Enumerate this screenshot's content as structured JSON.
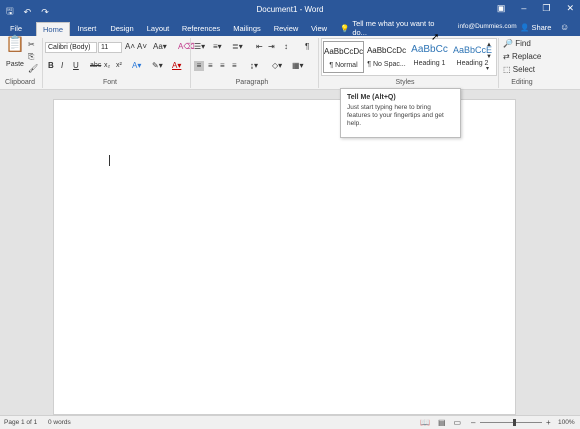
{
  "app": {
    "title": "Document1 - Word",
    "accent": "#2b579a"
  },
  "quick_access": [
    "save-icon",
    "undo-icon",
    "redo-icon"
  ],
  "tabs": [
    {
      "label": "File"
    },
    {
      "label": "Home"
    },
    {
      "label": "Insert"
    },
    {
      "label": "Design"
    },
    {
      "label": "Layout"
    },
    {
      "label": "References"
    },
    {
      "label": "Mailings"
    },
    {
      "label": "Review"
    },
    {
      "label": "View"
    }
  ],
  "tellme": {
    "text": "Tell me what you want to do..."
  },
  "account": {
    "email": "info@Dummies.com"
  },
  "share": {
    "label": "Share"
  },
  "ribbon": {
    "clipboard": {
      "paste_label": "Paste",
      "group": "Clipboard"
    },
    "font": {
      "family": "Calibri (Body)",
      "size": "11",
      "group": "Font"
    },
    "paragraph": {
      "group": "Paragraph"
    },
    "styles": {
      "group": "Styles",
      "items": [
        {
          "preview": "AaBbCcDc",
          "name": "¶ Normal"
        },
        {
          "preview": "AaBbCcDc",
          "name": "¶ No Spac..."
        },
        {
          "preview": "AaBbCc",
          "name": "Heading 1"
        },
        {
          "preview": "AaBbCcE",
          "name": "Heading 2"
        }
      ]
    },
    "editing": {
      "group": "Editing",
      "find": "Find",
      "replace": "Replace",
      "select": "Select"
    }
  },
  "tooltip": {
    "title": "Tell Me (Alt+Q)",
    "body": "Just start typing here to bring features to your fingertips and get help."
  },
  "status": {
    "page": "Page 1 of 1",
    "words": "0 words",
    "zoom": "100%"
  }
}
